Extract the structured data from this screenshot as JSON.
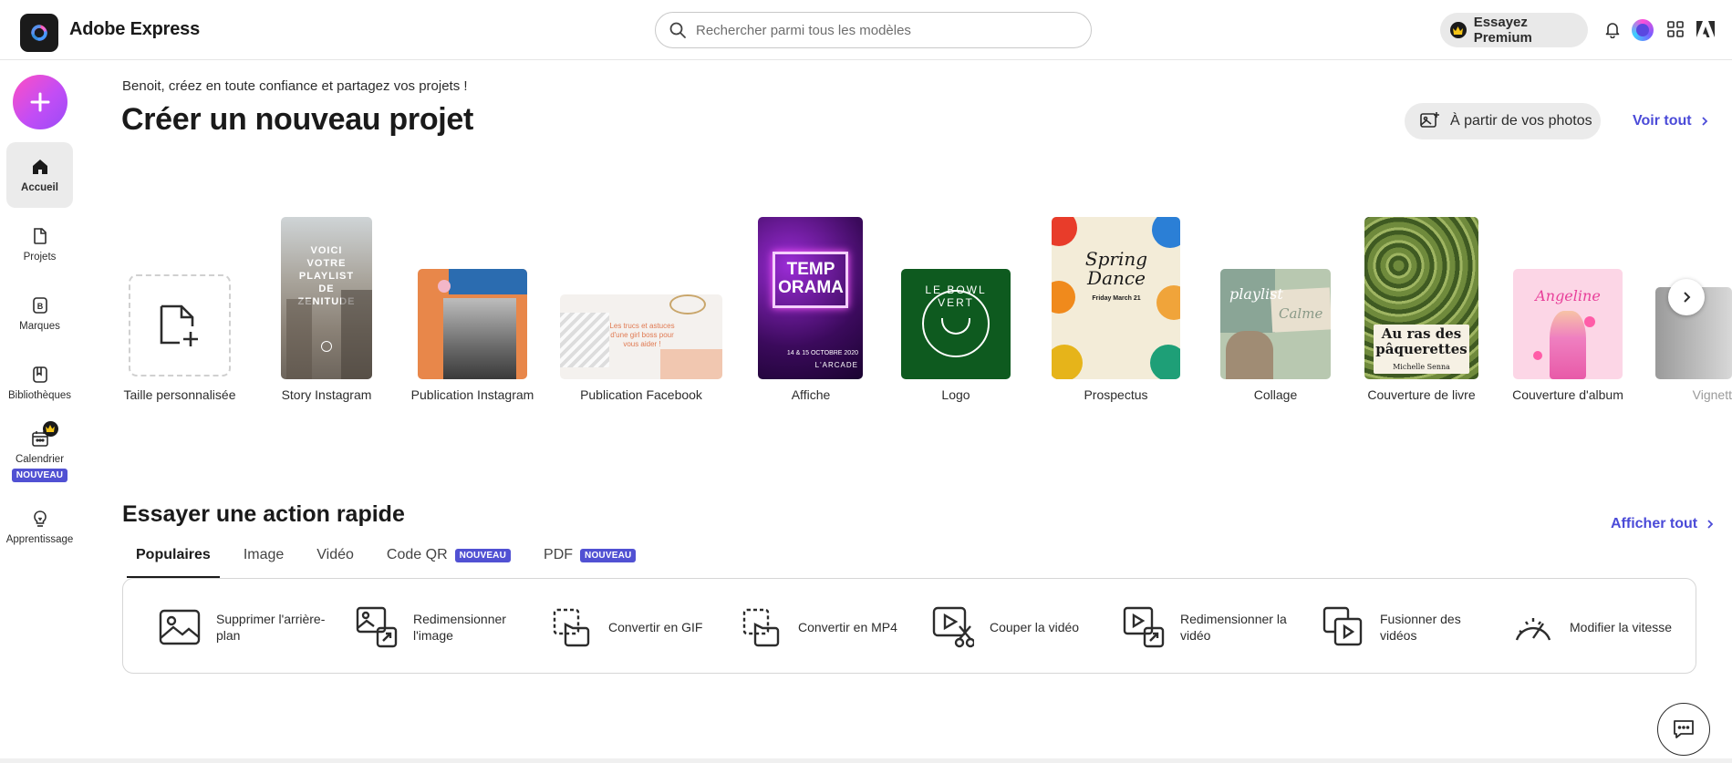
{
  "header": {
    "app_title": "Adobe Express",
    "search_placeholder": "Rechercher parmi tous les modèles",
    "premium_label": "Essayez Premium"
  },
  "sidebar": {
    "create_label": "+",
    "items": [
      {
        "label": "Accueil",
        "icon": "home-icon",
        "active": true
      },
      {
        "label": "Projets",
        "icon": "projects-icon"
      },
      {
        "label": "Marques",
        "icon": "brand-icon"
      },
      {
        "label": "Bibliothèques",
        "icon": "library-icon"
      },
      {
        "label": "Calendrier",
        "icon": "calendar-icon",
        "badge": "NOUVEAU"
      },
      {
        "label": "Apprentissage",
        "icon": "lightbulb-icon"
      }
    ]
  },
  "main": {
    "greeting": "Benoit, créez en toute confiance et partagez vos projets !",
    "title": "Créer un nouveau projet",
    "from_photos_label": "À partir de vos photos",
    "see_all_label": "Voir tout",
    "templates": [
      {
        "label": "Taille personnalisée"
      },
      {
        "label": "Story Instagram",
        "thumb_text": "VOICI VOTRE PLAYLIST DE ZENITUDE"
      },
      {
        "label": "Publication Instagram"
      },
      {
        "label": "Publication Facebook",
        "thumb_text": "Les trucs et astuces d'une girl boss pour vous aider !"
      },
      {
        "label": "Affiche",
        "thumb_text": "TEMP ORAMA",
        "thumb_sub": "14 & 15 OCTOBRE 2020",
        "thumb_sub2": "L'ARCADE"
      },
      {
        "label": "Logo",
        "thumb_text": "LE BOWL VERT"
      },
      {
        "label": "Prospectus",
        "thumb_text": "Spring Dance",
        "thumb_sub": "Friday March 21"
      },
      {
        "label": "Collage",
        "thumb_text": "playlist",
        "thumb_sub": "Calme"
      },
      {
        "label": "Couverture de livre",
        "thumb_text": "Au ras des pâquerettes",
        "thumb_sub": "Michelle Senna"
      },
      {
        "label": "Couverture d'album",
        "thumb_text": "Angeline"
      },
      {
        "label": "Vignett"
      }
    ]
  },
  "quick_actions": {
    "title": "Essayer une action rapide",
    "show_all_label": "Afficher tout",
    "tabs": [
      {
        "label": "Populaires",
        "active": true
      },
      {
        "label": "Image"
      },
      {
        "label": "Vidéo"
      },
      {
        "label": "Code QR",
        "badge": "NOUVEAU"
      },
      {
        "label": "PDF",
        "badge": "NOUVEAU"
      }
    ],
    "actions": [
      {
        "label": "Supprimer l'arrière-plan",
        "icon": "remove-background-icon"
      },
      {
        "label": "Redimensionner l'image",
        "icon": "resize-image-icon"
      },
      {
        "label": "Convertir en GIF",
        "icon": "convert-gif-icon"
      },
      {
        "label": "Convertir en MP4",
        "icon": "convert-mp4-icon"
      },
      {
        "label": "Couper la vidéo",
        "icon": "trim-video-icon"
      },
      {
        "label": "Redimensionner la vidéo",
        "icon": "resize-video-icon"
      },
      {
        "label": "Fusionner des vidéos",
        "icon": "merge-videos-icon"
      },
      {
        "label": "Modifier la vitesse",
        "icon": "speed-icon"
      }
    ]
  },
  "colors": {
    "accent": "#4b4bd8",
    "badge": "#5151d3",
    "fab_gradient_start": "#ff4fc3",
    "fab_gradient_end": "#9a4cf7"
  }
}
